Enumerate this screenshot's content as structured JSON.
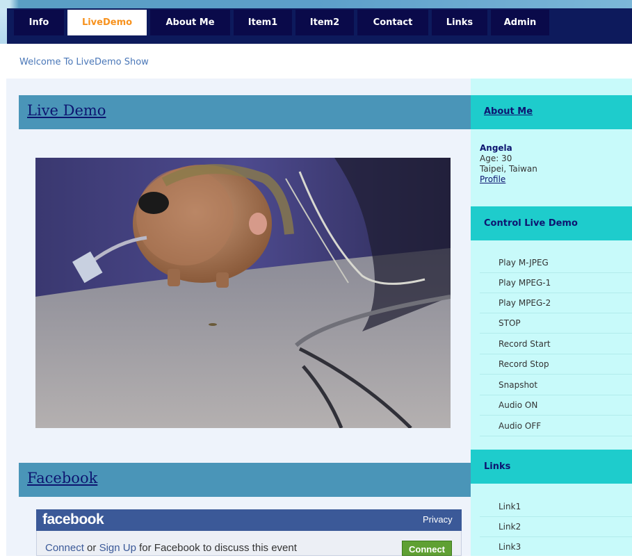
{
  "nav": {
    "tabs": [
      {
        "label": "Info",
        "active": false
      },
      {
        "label": "LiveDemo",
        "active": true
      },
      {
        "label": "About Me",
        "active": false
      },
      {
        "label": "Item1",
        "active": false
      },
      {
        "label": "Item2",
        "active": false
      },
      {
        "label": "Contact",
        "active": false
      },
      {
        "label": "Links",
        "active": false
      },
      {
        "label": "Admin",
        "active": false
      }
    ]
  },
  "welcome": "Welcome To LiveDemo Show",
  "main": {
    "live_demo_title": "Live Demo",
    "facebook_title": "Facebook"
  },
  "facebook": {
    "logo": "facebook",
    "privacy": "Privacy",
    "connect_link": "Connect",
    "or": " or ",
    "signup_link": "Sign Up",
    "rest": " for Facebook to discuss this event",
    "connect_button": "Connect"
  },
  "sidebar": {
    "about_title": "About Me",
    "name": "Angela",
    "age": "Age: 30",
    "location": "Taipei, Taiwan",
    "profile_link": "Profile",
    "control_title": "Control Live Demo",
    "control_items": [
      "Play M-JPEG",
      "Play MPEG-1",
      "Play MPEG-2",
      "STOP",
      "Record Start",
      "Record Stop",
      "Snapshot",
      "Audio ON",
      "Audio OFF"
    ],
    "links_title": "Links",
    "links": [
      "Link1",
      "Link2",
      "Link3"
    ]
  },
  "colors": {
    "nav_bg": "#0d1a5c",
    "active_tab_text": "#f7921e",
    "section_header": "#4a95b8",
    "sidebar_header": "#1ecccc",
    "sidebar_bg": "#c8fafa",
    "facebook_blue": "#3b5998"
  }
}
